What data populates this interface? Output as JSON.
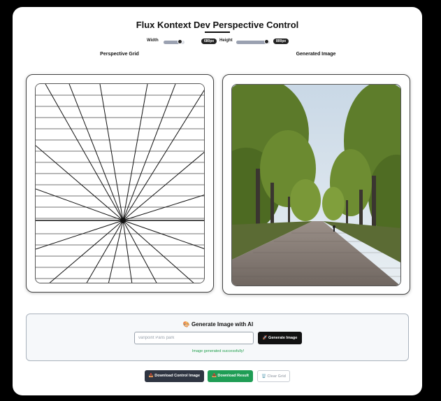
{
  "app": {
    "title": "Flux Kontext Dev Perspective Control"
  },
  "controls": {
    "width_label": "Width",
    "width_value": "680px",
    "width_fraction": 0.85,
    "height_label": "Height",
    "height_value": "800px",
    "height_fraction": 0.95
  },
  "panes": {
    "grid_label": "Perspective Grid",
    "generated_label": "Generated Image"
  },
  "generate": {
    "heading": "🎨 Generate Image with AI",
    "prompt_value": "",
    "prompt_placeholder": "vanpoint Paris park",
    "button_label": "🚀 Generate Image",
    "status": "Image generated successfully!"
  },
  "actions": {
    "download_control": "📥 Download Control Image",
    "download_result": "📥 Download Result",
    "clear_grid": "🗑️ Clear Grid"
  },
  "colors": {
    "dark_button": "#111111",
    "download_control_bg": "#2f3542",
    "download_result_bg": "#1f9d55",
    "success_text": "#1e9e4a"
  },
  "icons": [
    "palette-icon",
    "rocket-icon",
    "download-icon",
    "trash-icon"
  ]
}
